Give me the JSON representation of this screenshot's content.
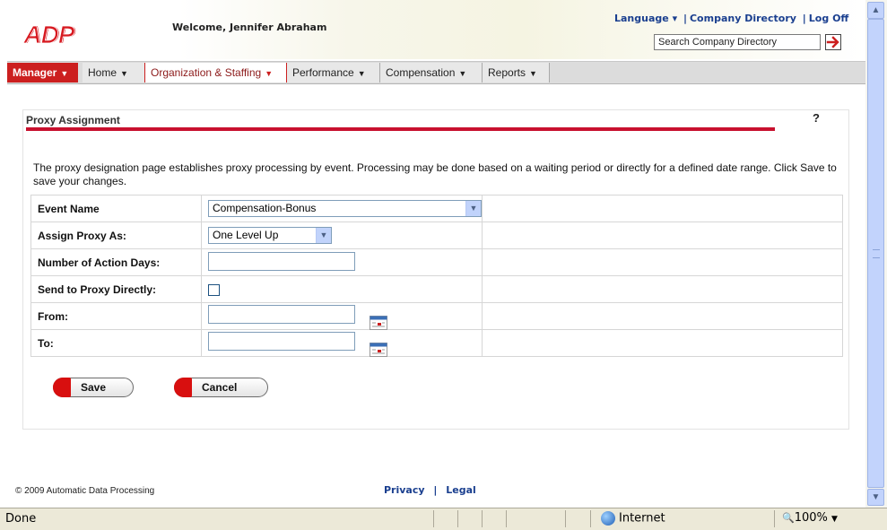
{
  "header": {
    "welcome": "Welcome, Jennifer Abraham",
    "links": [
      "Language",
      "Company Directory",
      "Log Off"
    ],
    "search_placeholder": "Search Company Directory"
  },
  "menu": {
    "items": [
      {
        "label": "Manager",
        "has_dropdown": true
      },
      {
        "label": "Home",
        "has_dropdown": true
      },
      {
        "label": "Organization & Staffing",
        "has_dropdown": true,
        "active": true
      },
      {
        "label": "Performance",
        "has_dropdown": true
      },
      {
        "label": "Compensation",
        "has_dropdown": true
      },
      {
        "label": "Reports",
        "has_dropdown": true
      }
    ]
  },
  "page": {
    "title": "Proxy Assignment",
    "help": "?",
    "description": "The proxy designation page establishes proxy processing by event.  Processing may be done based on a waiting  period or directly for a defined date range.  Click Save to save your changes."
  },
  "form": {
    "event_name": {
      "label": "Event Name",
      "value": "Compensation-Bonus"
    },
    "assign_proxy": {
      "label": "Assign Proxy As:",
      "value": "One Level Up"
    },
    "action_days": {
      "label": "Number of Action Days:",
      "value": ""
    },
    "send_direct": {
      "label": "Send to Proxy Directly:",
      "checked": false
    },
    "from": {
      "label": "From:",
      "value": ""
    },
    "to": {
      "label": "To:",
      "value": ""
    }
  },
  "buttons": {
    "save": "Save",
    "cancel": "Cancel"
  },
  "footer": {
    "copyright": "© 2009 Automatic Data Processing",
    "privacy": "Privacy",
    "legal": "Legal"
  },
  "statusbar": {
    "status": "Done",
    "zone": "Internet",
    "zoom": "100%"
  },
  "colors": {
    "brand_red": "#c8102e",
    "link_blue": "#1a3f8f",
    "menu_bg": "#dcdcdc"
  }
}
